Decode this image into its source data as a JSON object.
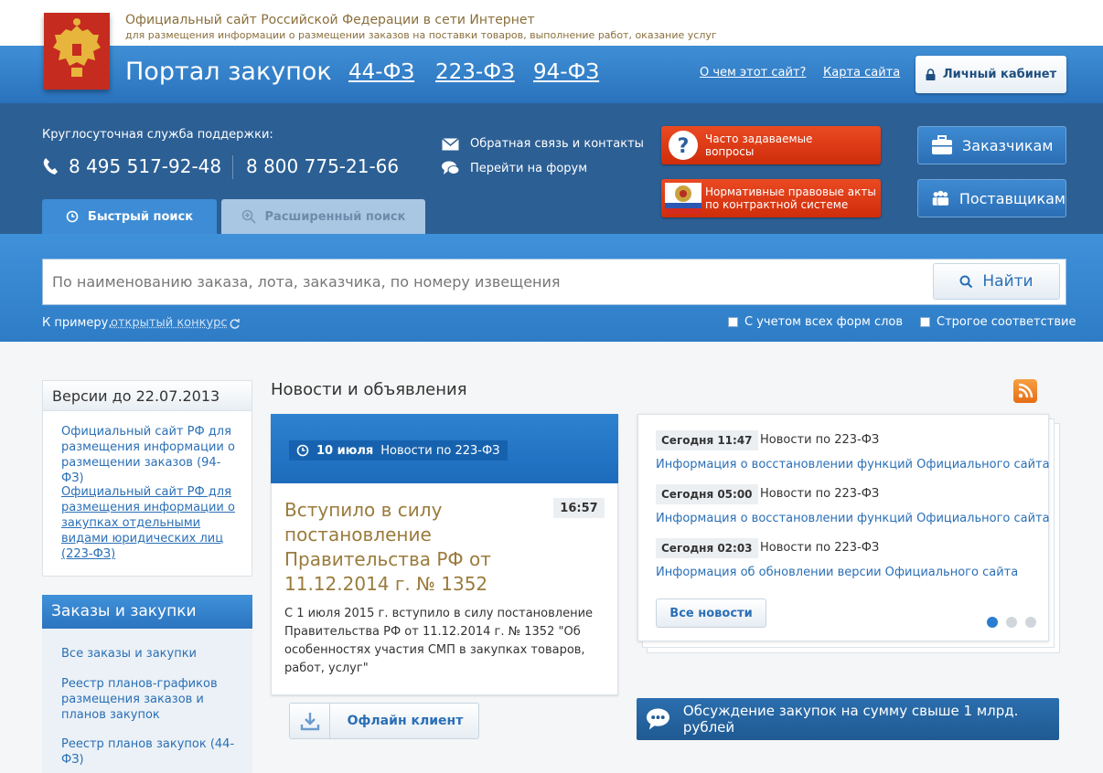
{
  "site": {
    "official_title": "Официальный сайт Российской Федерации в сети Интернет",
    "official_subtitle": "для размещения информации о размещении заказов на поставки товаров, выполнение работ, оказание услуг"
  },
  "header": {
    "portal_title": "Портал закупок",
    "law_links": [
      "44-ФЗ",
      "223-ФЗ",
      "94-ФЗ"
    ],
    "about_link": "О чем этот сайт?",
    "sitemap_link": "Карта сайта",
    "cabinet_button": "Личный кабинет"
  },
  "support": {
    "label": "Круглосуточная служба поддержки:",
    "phone1": "8 495 517-92-48",
    "phone2": "8 800 775-21-66",
    "feedback_link": "Обратная связь и контакты",
    "forum_link": "Перейти на форум"
  },
  "red_buttons": {
    "faq_line1": "Часто задаваемые",
    "faq_line2": "вопросы",
    "acts_line1": "Нормативные правовые акты",
    "acts_line2": "по контрактной системе"
  },
  "roles": {
    "customers": "Заказчикам",
    "suppliers": "Поставщикам"
  },
  "search": {
    "tab_quick": "Быстрый поиск",
    "tab_advanced": "Расширенный поиск",
    "placeholder": "По наименованию заказа, лота, заказчика, по номеру извещения",
    "find_button": "Найти",
    "example_label": "К примеру,",
    "example_link": "открытый конкурс",
    "check_word_forms": "С учетом всех форм слов",
    "check_strict": "Строгое соответствие"
  },
  "versions": {
    "heading": "Версии до 22.07.2013",
    "link1": "Официальный сайт РФ для размещения информации о размещении заказов (94-ФЗ)",
    "link2": "Официальный сайт РФ для размещения информации о закупках отдельными видами юридических лиц (223-ФЗ)"
  },
  "orders": {
    "heading": "Заказы и закупки",
    "items": [
      "Все заказы и закупки",
      "Реестр планов-графиков размещения заказов и планов закупок",
      "Реестр планов закупок (44-ФЗ)"
    ]
  },
  "news": {
    "heading": "Новости и объявления",
    "feature": {
      "date": "10 июля",
      "category": "Новости по 223-ФЗ",
      "time": "16:57",
      "headline": "Вступило в силу постановление Правительства РФ от 11.12.2014 г. № 1352",
      "text": "С 1 июля 2015 г. вступило в силу постановление Правительства РФ от 11.12.2014 г. № 1352 \"Об особенностях участия СМП в закупках товаров, работ, услуг\""
    },
    "items": [
      {
        "time": "Сегодня 11:47",
        "category": "Новости по 223-ФЗ",
        "title": "Информация о восстановлении функций Официального сайта"
      },
      {
        "time": "Сегодня 05:00",
        "category": "Новости по 223-ФЗ",
        "title": "Информация о восстановлении функций Официального сайта"
      },
      {
        "time": "Сегодня 02:03",
        "category": "Новости по 223-ФЗ",
        "title": "Информация об обновлении версии Официального сайта"
      }
    ],
    "all_news_button": "Все новости"
  },
  "offline_button": "Офлайн клиент",
  "discuss_button": "Обсуждение закупок на сумму свыше 1 млрд. рублей"
}
